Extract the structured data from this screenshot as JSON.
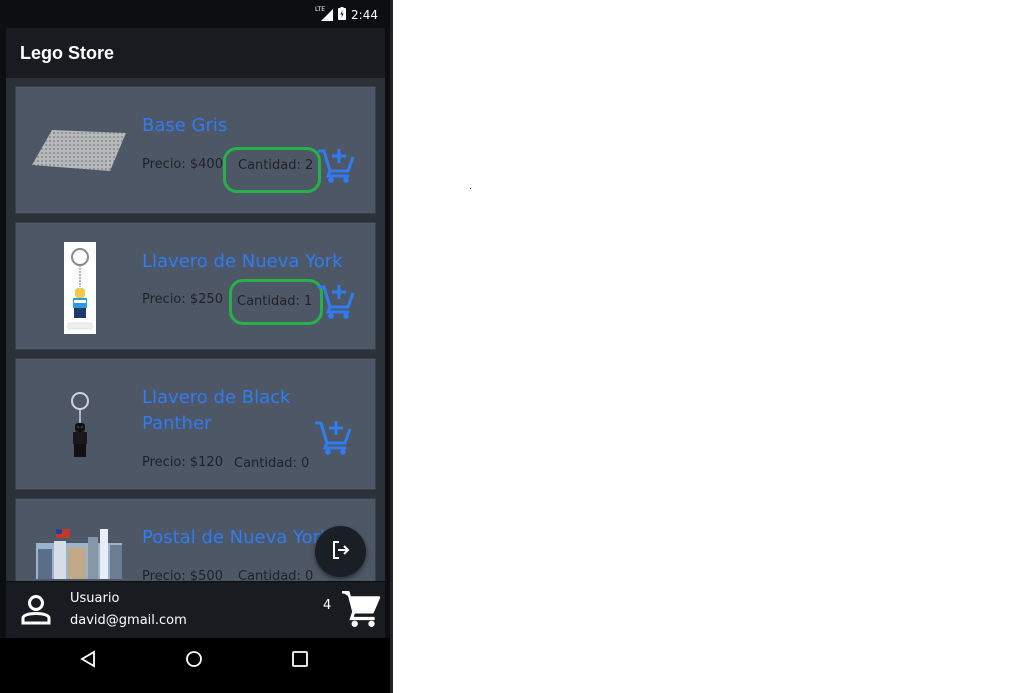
{
  "status_bar": {
    "network": "LTE",
    "time": "2:44"
  },
  "app_bar": {
    "title": "Lego Store"
  },
  "products": [
    {
      "name": "Base Gris",
      "price": "Precio: $400",
      "quantity": "Cantidad: 2"
    },
    {
      "name": "Llavero de Nueva York",
      "price": "Precio: $250",
      "quantity": "Cantidad: 1"
    },
    {
      "name": "Llavero de Black Panther",
      "price": "Precio: $120",
      "quantity": "Cantidad: 0"
    },
    {
      "name": "Postal de Nueva York",
      "price": "Precio: $500",
      "quantity": "Cantidad: 0"
    }
  ],
  "footer": {
    "user_label": "Usuario",
    "email": "david@gmail.com",
    "cart_count": "4"
  },
  "colors": {
    "accent": "#2f7cf4",
    "card": "#4e5765",
    "highlight": "#28b04a",
    "bar": "#181c21"
  },
  "icons": [
    "add-to-cart-icon",
    "logout-icon",
    "person-icon",
    "cart-icon",
    "back-icon",
    "home-icon",
    "recents-icon"
  ]
}
